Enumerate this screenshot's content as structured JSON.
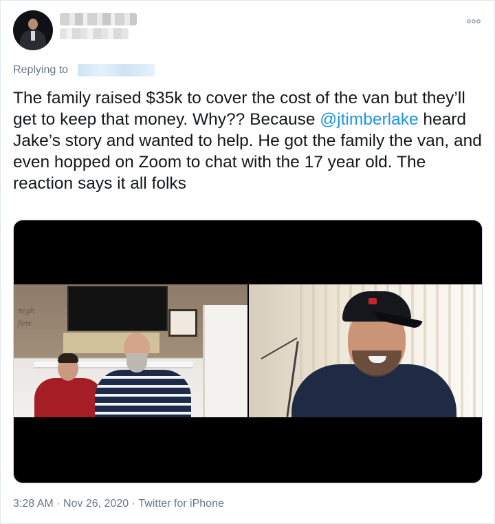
{
  "tweet": {
    "more_icon": "more-dots-icon",
    "reply_label": "Replying to",
    "text_parts": {
      "before": "The family raised $35k to cover the cost of the van but they’ll get to keep that money. Why?? Because ",
      "mention": "@jtimberlake",
      "after": " heard Jake’s story and wanted to help. He got the family the van, and even hopped on Zoom to chat with the 17 year old. The reaction says it all folks"
    },
    "deco_text_1": "nigh",
    "deco_text_2": "few",
    "time": "3:28 AM",
    "separator": "·",
    "date": "Nov 26, 2020",
    "source": "Twitter for iPhone",
    "colors": {
      "mention": "#1b95e0",
      "meta": "#657786",
      "text": "#14171a"
    }
  }
}
